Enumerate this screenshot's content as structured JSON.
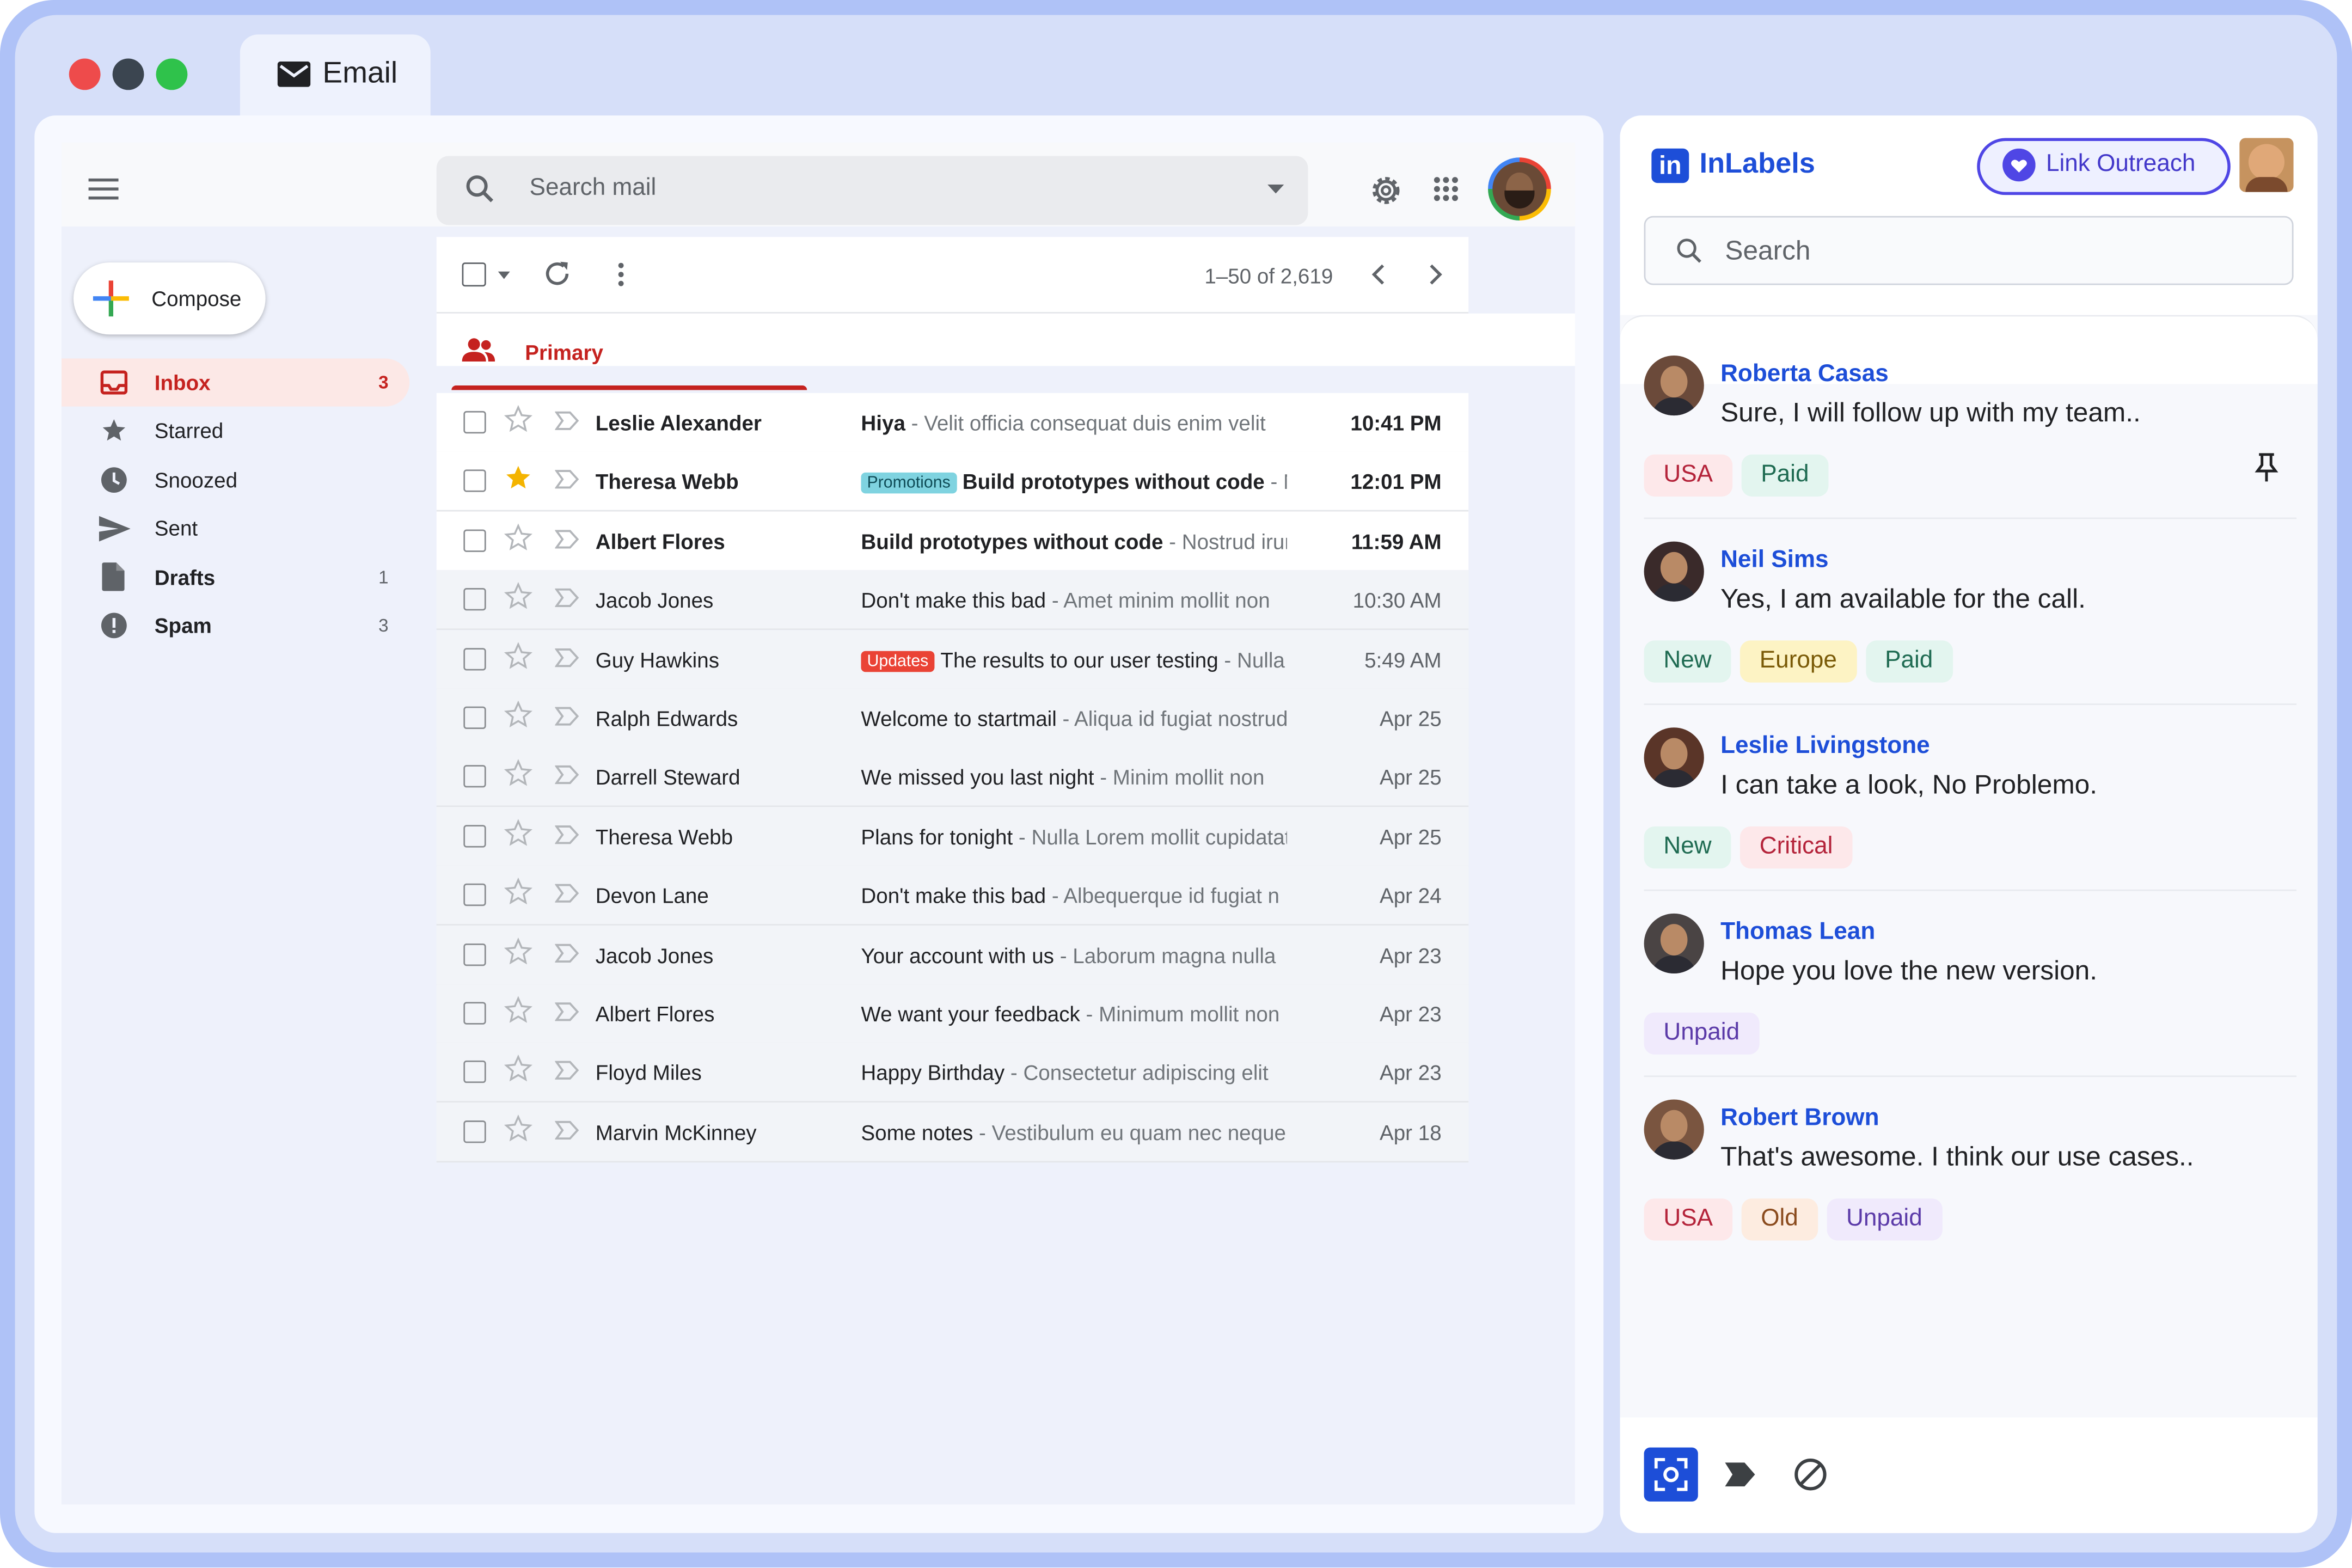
{
  "window": {
    "tab_title": "Email",
    "traffic_lights": [
      "#ee4b4b",
      "#3b4550",
      "#2fc24b"
    ]
  },
  "mail": {
    "search_placeholder": "Search mail",
    "compose_label": "Compose",
    "pagination": "1–50 of 2,619",
    "primary_tab": "Primary",
    "sidebar": [
      {
        "label": "Inbox",
        "count": "3",
        "icon": "inbox-icon",
        "active": true
      },
      {
        "label": "Starred",
        "count": "",
        "icon": "star-icon",
        "active": false
      },
      {
        "label": "Snoozed",
        "count": "",
        "icon": "clock-icon",
        "active": false
      },
      {
        "label": "Sent",
        "count": "",
        "icon": "send-icon",
        "active": false
      },
      {
        "label": "Drafts",
        "count": "1",
        "icon": "draft-icon",
        "active": false
      },
      {
        "label": "Spam",
        "count": "3",
        "icon": "spam-icon",
        "active": false
      }
    ],
    "rows": [
      {
        "sender": "Leslie Alexander",
        "badge": "",
        "subject": "Hiya",
        "snippet": "Velit officia consequat duis enim velit",
        "time": "10:41 PM",
        "unread": true,
        "starred": false
      },
      {
        "sender": "Theresa Webb",
        "badge": "Promotions",
        "subject": "Build prototypes without code",
        "snippet": "Nostrud",
        "time": "12:01 PM",
        "unread": true,
        "starred": true
      },
      {
        "sender": "Albert Flores",
        "badge": "",
        "subject": "Build prototypes without code",
        "snippet": "Nostrud irure",
        "time": "11:59 AM",
        "unread": true,
        "starred": false
      },
      {
        "sender": "Jacob Jones",
        "badge": "",
        "subject": "Don't make this bad",
        "snippet": "Amet minim mollit non",
        "time": "10:30 AM",
        "unread": false,
        "starred": false
      },
      {
        "sender": "Guy Hawkins",
        "badge": "Updates",
        "subject": "The results to our user testing",
        "snippet": "Nulla",
        "time": "5:49 AM",
        "unread": false,
        "starred": false
      },
      {
        "sender": "Ralph Edwards",
        "badge": "",
        "subject": "Welcome to startmail",
        "snippet": "Aliqua id fugiat nostrud",
        "time": "Apr 25",
        "unread": false,
        "starred": false
      },
      {
        "sender": "Darrell Steward",
        "badge": "",
        "subject": "We missed you last night",
        "snippet": "Minim mollit non",
        "time": "Apr 25",
        "unread": false,
        "starred": false
      },
      {
        "sender": "Theresa Webb",
        "badge": "",
        "subject": "Plans for tonight",
        "snippet": "Nulla Lorem mollit cupidatat",
        "time": "Apr 25",
        "unread": false,
        "starred": false
      },
      {
        "sender": "Devon Lane",
        "badge": "",
        "subject": "Don't make this bad",
        "snippet": "Albequerque id fugiat n",
        "time": "Apr 24",
        "unread": false,
        "starred": false
      },
      {
        "sender": "Jacob Jones",
        "badge": "",
        "subject": "Your account with us",
        "snippet": "Laborum magna nulla",
        "time": "Apr 23",
        "unread": false,
        "starred": false
      },
      {
        "sender": "Albert Flores",
        "badge": "",
        "subject": "We want your feedback",
        "snippet": "Minimum mollit non",
        "time": "Apr 23",
        "unread": false,
        "starred": false
      },
      {
        "sender": "Floyd Miles",
        "badge": "",
        "subject": "Happy Birthday",
        "snippet": "Consectetur adipiscing elit",
        "time": "Apr 23",
        "unread": false,
        "starred": false
      },
      {
        "sender": "Marvin McKinney",
        "badge": "",
        "subject": "Some notes",
        "snippet": "Vestibulum eu quam nec neque",
        "time": "Apr 18",
        "unread": false,
        "starred": false
      }
    ]
  },
  "inlabels": {
    "logo_mark": "in",
    "brand": "InLabels",
    "link_button": "Link Outreach",
    "search_placeholder": "Search",
    "contacts": [
      {
        "name": "Roberta Casas",
        "message": "Sure, I will follow up with my team..",
        "tags": [
          "USA",
          "Paid"
        ],
        "pinned": true,
        "avatar_color": "#6b4a3a"
      },
      {
        "name": "Neil Sims",
        "message": "Yes, I am available for the call.",
        "tags": [
          "New",
          "Europe",
          "Paid"
        ],
        "pinned": false,
        "avatar_color": "#3a2a2a"
      },
      {
        "name": "Leslie Livingstone",
        "message": "I can take a look, No Problemo.",
        "tags": [
          "New",
          "Critical"
        ],
        "pinned": false,
        "avatar_color": "#5a3528"
      },
      {
        "name": "Thomas Lean",
        "message": "Hope you love the new version.",
        "tags": [
          "Unpaid"
        ],
        "pinned": false,
        "avatar_color": "#4a4444"
      },
      {
        "name": "Robert Brown",
        "message": "That's awesome. I think our use cases..",
        "tags": [
          "USA",
          "Old",
          "Unpaid"
        ],
        "pinned": false,
        "avatar_color": "#7a5540"
      }
    ],
    "tag_colors": {
      "USA": [
        "#fde8ea",
        "#b4233a"
      ],
      "Paid": [
        "#e3f5ef",
        "#1f6b52"
      ],
      "New": [
        "#e3f5ef",
        "#1f6b52"
      ],
      "Europe": [
        "#fdf3c4",
        "#7a5a07"
      ],
      "Critical": [
        "#fde8ea",
        "#b4233a"
      ],
      "Unpaid": [
        "#f0eafc",
        "#5b3aa8"
      ],
      "Old": [
        "#fdece0",
        "#8a4a1c"
      ]
    },
    "accent": "#1d4ed8"
  }
}
